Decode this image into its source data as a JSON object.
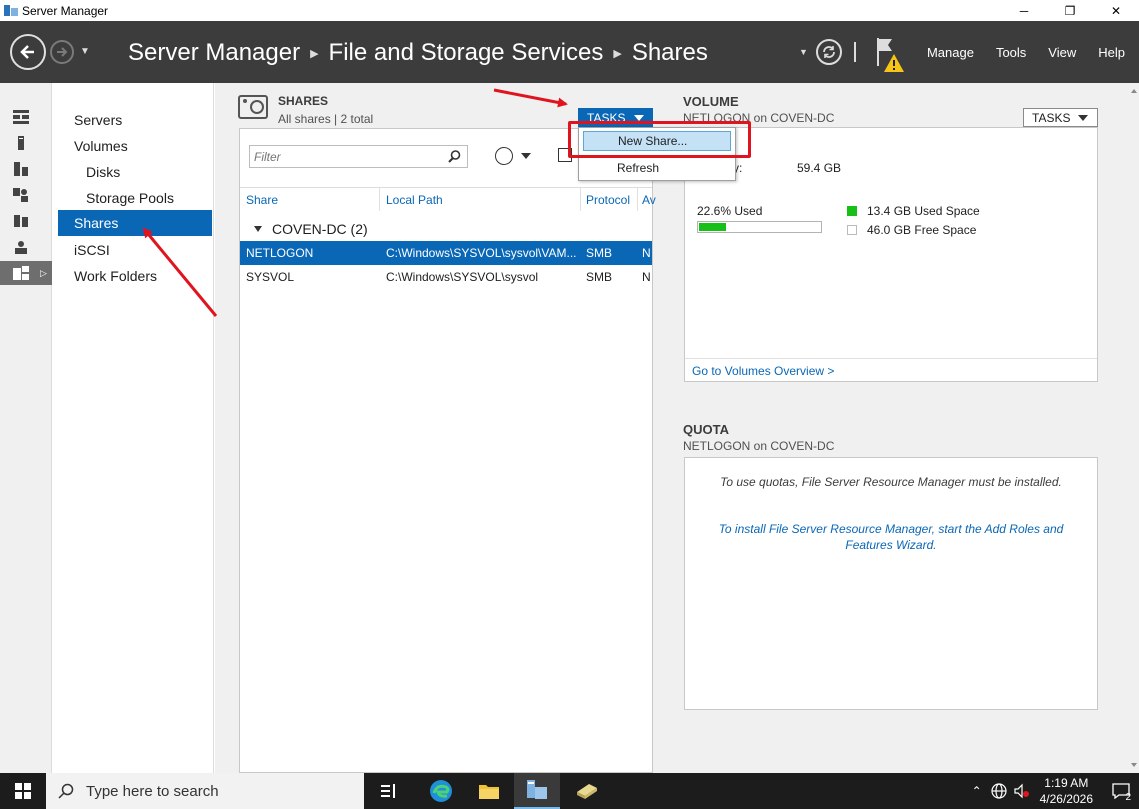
{
  "window": {
    "title": "Server Manager",
    "controls": [
      "─",
      "❐",
      "✕"
    ]
  },
  "header": {
    "breadcrumb": [
      "Server Manager",
      "File and Storage Services",
      "Shares"
    ],
    "menu": [
      "Manage",
      "Tools",
      "View",
      "Help"
    ]
  },
  "nav": {
    "items": [
      {
        "label": "Servers",
        "sub": false,
        "active": false
      },
      {
        "label": "Volumes",
        "sub": false,
        "active": false
      },
      {
        "label": "Disks",
        "sub": true,
        "active": false
      },
      {
        "label": "Storage Pools",
        "sub": true,
        "active": false
      },
      {
        "label": "Shares",
        "sub": false,
        "active": true
      },
      {
        "label": "iSCSI",
        "sub": false,
        "active": false
      },
      {
        "label": "Work Folders",
        "sub": false,
        "active": false
      }
    ]
  },
  "shares": {
    "title": "SHARES",
    "subtitle": "All shares | 2 total",
    "tasks_label": "TASKS",
    "filter_placeholder": "Filter",
    "columns": [
      "Share",
      "Local Path",
      "Protocol",
      "Av"
    ],
    "group_label": "COVEN-DC (2)",
    "rows": [
      {
        "share": "NETLOGON",
        "path": "C:\\Windows\\SYSVOL\\sysvol\\VAM...",
        "protocol": "SMB",
        "av": "N",
        "selected": true
      },
      {
        "share": "SYSVOL",
        "path": "C:\\Windows\\SYSVOL\\sysvol",
        "protocol": "SMB",
        "av": "N",
        "selected": false
      }
    ]
  },
  "tasks_menu": {
    "items": [
      "New Share...",
      "Refresh"
    ],
    "highlighted": "New Share..."
  },
  "volume": {
    "title": "VOLUME",
    "subtitle": "NETLOGON on COVEN-DC",
    "tasks_label": "TASKS",
    "capacity_label": "y:",
    "capacity_value": "59.4 GB",
    "used_pct_label": "22.6% Used",
    "used_fraction": 0.226,
    "used_space": "13.4 GB Used Space",
    "free_space": "46.0 GB Free Space",
    "link": "Go to Volumes Overview >",
    "used_color": "#16c016"
  },
  "quota": {
    "title": "QUOTA",
    "subtitle": "NETLOGON on COVEN-DC",
    "message": "To use quotas, File Server Resource Manager must be installed.",
    "link": "To install File Server Resource Manager, start the Add Roles and Features Wizard."
  },
  "taskbar": {
    "search_placeholder": "Type here to search",
    "time": "1:19 AM",
    "date": "4/26/2026",
    "notifications": "2"
  },
  "colors": {
    "accent": "#0a67b6",
    "header_bg": "#3c3c3c",
    "annotation": "#e0141e"
  }
}
